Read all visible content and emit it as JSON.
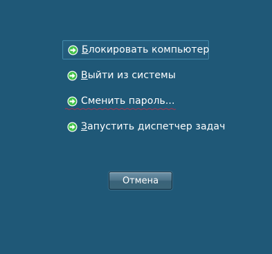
{
  "options": [
    {
      "label": "Блокировать компьютер",
      "icon": "green-arrow-icon"
    },
    {
      "label": "Выйти из системы",
      "icon": "green-arrow-icon"
    },
    {
      "label": "Сменить пароль...",
      "icon": "green-arrow-icon"
    },
    {
      "label": "Запустить диспетчер задач",
      "icon": "green-arrow-icon"
    }
  ],
  "cancel_label": "Отмена",
  "colors": {
    "background": "#1f5877",
    "focus_border": "#3f86a8",
    "arrow_green": "#41c14a",
    "spell_underline": "#c0304a"
  }
}
